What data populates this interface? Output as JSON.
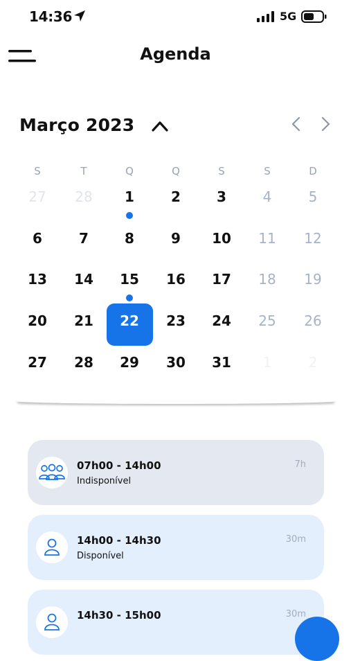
{
  "status_bar": {
    "time": "14:36",
    "network": "5G"
  },
  "header": {
    "title": "Agenda"
  },
  "calendar": {
    "month_label": "Março 2023",
    "weekdays": [
      "S",
      "T",
      "Q",
      "Q",
      "S",
      "S",
      "D"
    ],
    "weeks": [
      [
        "27",
        "28",
        "1",
        "2",
        "3",
        "4",
        "5"
      ],
      [
        "6",
        "7",
        "8",
        "9",
        "10",
        "11",
        "12"
      ],
      [
        "13",
        "14",
        "15",
        "16",
        "17",
        "18",
        "19"
      ],
      [
        "20",
        "21",
        "22",
        "23",
        "24",
        "25",
        "26"
      ],
      [
        "27",
        "28",
        "29",
        "30",
        "31",
        "1",
        "2"
      ]
    ],
    "selected_day": "22",
    "marked_days": [
      "1",
      "15"
    ]
  },
  "slots": [
    {
      "time": "07h00 - 14h00",
      "status": "Indisponível",
      "duration": "7h",
      "icon": "group-icon"
    },
    {
      "time": "14h00 - 14h30",
      "status": "Disponível",
      "duration": "30m",
      "icon": "person-icon"
    },
    {
      "time": "14h30 - 15h00",
      "status": "",
      "duration": "30m",
      "icon": "person-icon"
    }
  ],
  "colors": {
    "accent": "#1773e8",
    "unavailable_bg": "#e4e8f0",
    "available_bg": "#e4effd"
  }
}
